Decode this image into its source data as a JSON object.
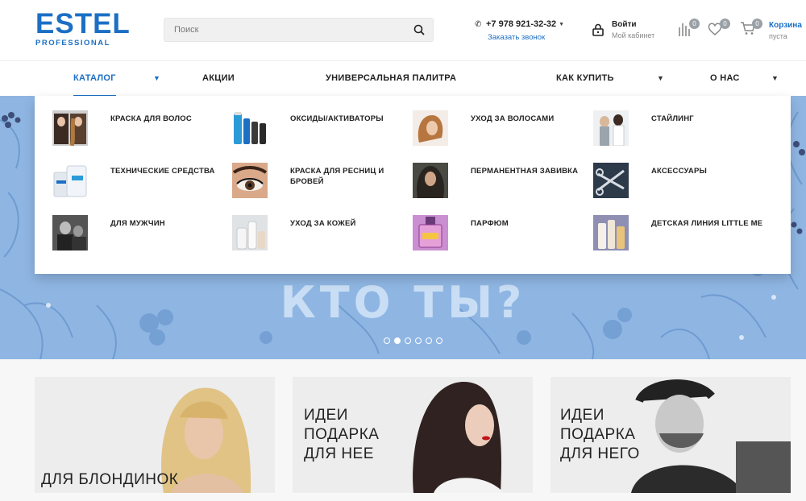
{
  "header": {
    "logo": {
      "brand": "ESTEL",
      "sub": "PROFESSIONAL"
    },
    "search": {
      "placeholder": "Поиск"
    },
    "phone": "+7 978 921-32-32",
    "callback": "Заказать звонок",
    "login": {
      "title": "Войти",
      "subtitle": "Мой кабинет"
    },
    "compare_count": "0",
    "favorites_count": "0",
    "cart": {
      "count": "0",
      "title": "Корзина",
      "subtitle": "пуста"
    }
  },
  "nav": {
    "items": [
      {
        "label": "КАТАЛОГ",
        "active": true
      },
      {
        "label": "АКЦИИ"
      },
      {
        "label": "УНИВЕРСАЛЬНАЯ ПАЛИТРА"
      },
      {
        "label": "КАК КУПИТЬ"
      },
      {
        "label": "О НАС"
      }
    ]
  },
  "catalog": {
    "items": [
      {
        "label": "КРАСКА ДЛЯ ВОЛОС"
      },
      {
        "label": "ОКСИДЫ/АКТИВАТОРЫ"
      },
      {
        "label": "УХОД ЗА ВОЛОСАМИ"
      },
      {
        "label": "СТАЙЛИНГ"
      },
      {
        "label": "ТЕХНИЧЕСКИЕ СРЕДСТВА"
      },
      {
        "label": "КРАСКА ДЛЯ РЕСНИЦ И БРОВЕЙ"
      },
      {
        "label": "ПЕРМАНЕНТНАЯ ЗАВИВКА"
      },
      {
        "label": "АКСЕССУАРЫ"
      },
      {
        "label": "ДЛЯ МУЖЧИН"
      },
      {
        "label": "УХОД ЗА КОЖЕЙ"
      },
      {
        "label": "ПАРФЮМ"
      },
      {
        "label": "ДЕТСКАЯ ЛИНИЯ LITTLE ME"
      }
    ]
  },
  "hero": {
    "title": "КТО ТЫ?",
    "slides": 6,
    "active_slide": 2
  },
  "promos": [
    {
      "label": "ДЛЯ БЛОНДИНОК"
    },
    {
      "label": "ИДЕИ ПОДАРКА ДЛЯ НЕЕ"
    },
    {
      "label": "ИДЕИ ПОДАРКА ДЛЯ НЕГО"
    }
  ],
  "colors": {
    "accent": "#1b6fc4",
    "hero_bg": "#8fb6e3",
    "badge": "#9aa0a6"
  }
}
